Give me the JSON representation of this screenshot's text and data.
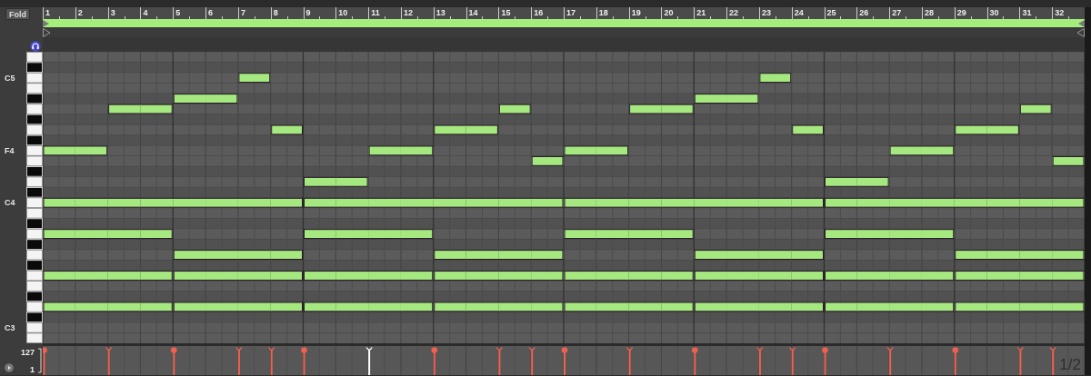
{
  "toolbar": {
    "fold_button": "Fold"
  },
  "ruler": {
    "bars": [
      "1",
      "2",
      "3",
      "4",
      "5",
      "6",
      "7",
      "8",
      "9",
      "10",
      "11",
      "12",
      "13",
      "14",
      "15",
      "16",
      "17",
      "18",
      "19",
      "20",
      "21",
      "22",
      "23",
      "24",
      "25",
      "26",
      "27",
      "28",
      "29",
      "30",
      "31",
      "32"
    ]
  },
  "rows": [
    {
      "black_key": false
    },
    {
      "black_key": true
    },
    {
      "black_key": false,
      "label": "C5",
      "bars": [
        {
          "on": false
        },
        {
          "on": false
        },
        {
          "on": false
        },
        {
          "on": false
        },
        {
          "on": false
        },
        {
          "on": false
        },
        {
          "on": true,
          "start": true,
          "selected": false
        },
        {
          "on": false
        },
        {
          "on": false
        },
        {
          "on": false
        },
        {
          "on": false
        },
        {
          "on": false
        },
        {
          "on": false
        },
        {
          "on": false
        },
        {
          "on": false
        },
        {
          "on": false
        },
        {
          "on": false
        },
        {
          "on": false
        },
        {
          "on": false
        },
        {
          "on": false
        },
        {
          "on": false
        },
        {
          "on": false
        },
        {
          "on": true,
          "start": true,
          "selected": false
        },
        {
          "on": false
        },
        {
          "on": false
        },
        {
          "on": false
        },
        {
          "on": false
        },
        {
          "on": false
        },
        {
          "on": false
        },
        {
          "on": false
        },
        {
          "on": false
        },
        {
          "on": false
        }
      ]
    },
    {
      "black_key": false
    },
    {
      "black_key": true,
      "bars": [
        {
          "on": false
        },
        {
          "on": false
        },
        {
          "on": false
        },
        {
          "on": false
        },
        {
          "on": true,
          "start": true,
          "selected": false
        },
        {
          "on": true,
          "start": false
        },
        {
          "on": false
        },
        {
          "on": false
        },
        {
          "on": false
        },
        {
          "on": false
        },
        {
          "on": false
        },
        {
          "on": false
        },
        {
          "on": false
        },
        {
          "on": false
        },
        {
          "on": false
        },
        {
          "on": false
        },
        {
          "on": false
        },
        {
          "on": false
        },
        {
          "on": false
        },
        {
          "on": false
        },
        {
          "on": true,
          "start": true,
          "selected": false
        },
        {
          "on": true,
          "start": false
        },
        {
          "on": false
        },
        {
          "on": false
        },
        {
          "on": false
        },
        {
          "on": false
        },
        {
          "on": false
        },
        {
          "on": false
        },
        {
          "on": false
        },
        {
          "on": false
        },
        {
          "on": false
        },
        {
          "on": false
        }
      ]
    },
    {
      "black_key": false,
      "bars": [
        {
          "on": false
        },
        {
          "on": false
        },
        {
          "on": true,
          "start": true,
          "selected": false
        },
        {
          "on": true,
          "start": false
        },
        {
          "on": false
        },
        {
          "on": false
        },
        {
          "on": false
        },
        {
          "on": false
        },
        {
          "on": false
        },
        {
          "on": false
        },
        {
          "on": false
        },
        {
          "on": false
        },
        {
          "on": false
        },
        {
          "on": false
        },
        {
          "on": true,
          "start": true,
          "selected": false
        },
        {
          "on": false
        },
        {
          "on": false
        },
        {
          "on": false
        },
        {
          "on": true,
          "start": true,
          "selected": false
        },
        {
          "on": true,
          "start": false
        },
        {
          "on": false
        },
        {
          "on": false
        },
        {
          "on": false
        },
        {
          "on": false
        },
        {
          "on": false
        },
        {
          "on": false
        },
        {
          "on": false
        },
        {
          "on": false
        },
        {
          "on": false
        },
        {
          "on": false
        },
        {
          "on": true,
          "start": true,
          "selected": false
        },
        {
          "on": false
        }
      ]
    },
    {
      "black_key": true
    },
    {
      "black_key": false,
      "bars": [
        {
          "on": false
        },
        {
          "on": false
        },
        {
          "on": false
        },
        {
          "on": false
        },
        {
          "on": false
        },
        {
          "on": false
        },
        {
          "on": false
        },
        {
          "on": true,
          "start": true,
          "selected": false
        },
        {
          "on": false
        },
        {
          "on": false
        },
        {
          "on": false
        },
        {
          "on": false
        },
        {
          "on": true,
          "start": true,
          "selected": false
        },
        {
          "on": true,
          "start": false
        },
        {
          "on": false
        },
        {
          "on": false
        },
        {
          "on": false
        },
        {
          "on": false
        },
        {
          "on": false
        },
        {
          "on": false
        },
        {
          "on": false
        },
        {
          "on": false
        },
        {
          "on": false
        },
        {
          "on": true,
          "start": true,
          "selected": false
        },
        {
          "on": false
        },
        {
          "on": false
        },
        {
          "on": false
        },
        {
          "on": false
        },
        {
          "on": true,
          "start": true,
          "selected": false
        },
        {
          "on": true,
          "start": false
        },
        {
          "on": false
        },
        {
          "on": false
        }
      ]
    },
    {
      "black_key": true
    },
    {
      "black_key": false,
      "label": "F4",
      "bars": [
        {
          "on": true,
          "start": true,
          "selected": false
        },
        {
          "on": true,
          "start": false
        },
        {
          "on": false
        },
        {
          "on": false
        },
        {
          "on": false
        },
        {
          "on": false
        },
        {
          "on": false
        },
        {
          "on": false
        },
        {
          "on": false
        },
        {
          "on": false
        },
        {
          "on": true,
          "start": true,
          "selected": true
        },
        {
          "on": true,
          "start": false
        },
        {
          "on": false
        },
        {
          "on": false
        },
        {
          "on": false
        },
        {
          "on": false
        },
        {
          "on": true,
          "start": true,
          "selected": false
        },
        {
          "on": true,
          "start": false
        },
        {
          "on": false
        },
        {
          "on": false
        },
        {
          "on": false
        },
        {
          "on": false
        },
        {
          "on": false
        },
        {
          "on": false
        },
        {
          "on": false
        },
        {
          "on": false
        },
        {
          "on": true,
          "start": true,
          "selected": false
        },
        {
          "on": true,
          "start": false
        },
        {
          "on": false
        },
        {
          "on": false
        },
        {
          "on": false
        },
        {
          "on": false
        }
      ]
    },
    {
      "black_key": false,
      "bars": [
        {
          "on": false
        },
        {
          "on": false
        },
        {
          "on": false
        },
        {
          "on": false
        },
        {
          "on": false
        },
        {
          "on": false
        },
        {
          "on": false
        },
        {
          "on": false
        },
        {
          "on": false
        },
        {
          "on": false
        },
        {
          "on": false
        },
        {
          "on": false
        },
        {
          "on": false
        },
        {
          "on": false
        },
        {
          "on": false
        },
        {
          "on": true,
          "start": true,
          "selected": false
        },
        {
          "on": false
        },
        {
          "on": false
        },
        {
          "on": false
        },
        {
          "on": false
        },
        {
          "on": false
        },
        {
          "on": false
        },
        {
          "on": false
        },
        {
          "on": false
        },
        {
          "on": false
        },
        {
          "on": false
        },
        {
          "on": false
        },
        {
          "on": false
        },
        {
          "on": false
        },
        {
          "on": false
        },
        {
          "on": false
        },
        {
          "on": true,
          "start": true,
          "selected": false
        }
      ]
    },
    {
      "black_key": true
    },
    {
      "black_key": false,
      "bars": [
        {
          "on": false
        },
        {
          "on": false
        },
        {
          "on": false
        },
        {
          "on": false
        },
        {
          "on": false
        },
        {
          "on": false
        },
        {
          "on": false
        },
        {
          "on": false
        },
        {
          "on": true,
          "start": true,
          "selected": false
        },
        {
          "on": true,
          "start": false
        },
        {
          "on": false
        },
        {
          "on": false
        },
        {
          "on": false
        },
        {
          "on": false
        },
        {
          "on": false
        },
        {
          "on": false
        },
        {
          "on": false
        },
        {
          "on": false
        },
        {
          "on": false
        },
        {
          "on": false
        },
        {
          "on": false
        },
        {
          "on": false
        },
        {
          "on": false
        },
        {
          "on": false
        },
        {
          "on": true,
          "start": true,
          "selected": false
        },
        {
          "on": true,
          "start": false
        },
        {
          "on": false
        },
        {
          "on": false
        },
        {
          "on": false
        },
        {
          "on": false
        },
        {
          "on": false
        },
        {
          "on": false
        }
      ]
    },
    {
      "black_key": true
    },
    {
      "black_key": false,
      "label": "C4",
      "bars": [
        {
          "on": true,
          "start": true,
          "selected": false
        },
        {
          "on": true,
          "start": false
        },
        {
          "on": true,
          "start": false
        },
        {
          "on": true,
          "start": false
        },
        {
          "on": true,
          "start": false
        },
        {
          "on": true,
          "start": false
        },
        {
          "on": true,
          "start": false
        },
        {
          "on": true,
          "start": false
        },
        {
          "on": true,
          "start": true,
          "selected": false
        },
        {
          "on": true,
          "start": false
        },
        {
          "on": true,
          "start": false
        },
        {
          "on": true,
          "start": false
        },
        {
          "on": true,
          "start": false
        },
        {
          "on": true,
          "start": false
        },
        {
          "on": true,
          "start": false
        },
        {
          "on": true,
          "start": false
        },
        {
          "on": true,
          "start": true,
          "selected": false
        },
        {
          "on": true,
          "start": false
        },
        {
          "on": true,
          "start": false
        },
        {
          "on": true,
          "start": false
        },
        {
          "on": true,
          "start": false
        },
        {
          "on": true,
          "start": false
        },
        {
          "on": true,
          "start": false
        },
        {
          "on": true,
          "start": false
        },
        {
          "on": true,
          "start": true,
          "selected": false
        },
        {
          "on": true,
          "start": false
        },
        {
          "on": true,
          "start": false
        },
        {
          "on": true,
          "start": false
        },
        {
          "on": true,
          "start": false
        },
        {
          "on": true,
          "start": false
        },
        {
          "on": true,
          "start": false
        },
        {
          "on": true,
          "start": false
        }
      ]
    },
    {
      "black_key": false
    },
    {
      "black_key": true
    },
    {
      "black_key": false,
      "bars": [
        {
          "on": true,
          "start": true,
          "selected": false
        },
        {
          "on": true,
          "start": false
        },
        {
          "on": true,
          "start": false
        },
        {
          "on": true,
          "start": false
        },
        {
          "on": false
        },
        {
          "on": false
        },
        {
          "on": false
        },
        {
          "on": false
        },
        {
          "on": true,
          "start": true,
          "selected": false
        },
        {
          "on": true,
          "start": false
        },
        {
          "on": true,
          "start": false
        },
        {
          "on": true,
          "start": false
        },
        {
          "on": false
        },
        {
          "on": false
        },
        {
          "on": false
        },
        {
          "on": false
        },
        {
          "on": true,
          "start": true,
          "selected": false
        },
        {
          "on": true,
          "start": false
        },
        {
          "on": true,
          "start": false
        },
        {
          "on": true,
          "start": false
        },
        {
          "on": false
        },
        {
          "on": false
        },
        {
          "on": false
        },
        {
          "on": false
        },
        {
          "on": true,
          "start": true,
          "selected": false
        },
        {
          "on": true,
          "start": false
        },
        {
          "on": true,
          "start": false
        },
        {
          "on": true,
          "start": false
        },
        {
          "on": false
        },
        {
          "on": false
        },
        {
          "on": false
        },
        {
          "on": false
        }
      ]
    },
    {
      "black_key": true
    },
    {
      "black_key": false,
      "bars": [
        {
          "on": false
        },
        {
          "on": false
        },
        {
          "on": false
        },
        {
          "on": false
        },
        {
          "on": true,
          "start": true,
          "selected": false
        },
        {
          "on": true,
          "start": false
        },
        {
          "on": true,
          "start": false
        },
        {
          "on": true,
          "start": false
        },
        {
          "on": false
        },
        {
          "on": false
        },
        {
          "on": false
        },
        {
          "on": false
        },
        {
          "on": true,
          "start": true,
          "selected": false
        },
        {
          "on": true,
          "start": false
        },
        {
          "on": true,
          "start": false
        },
        {
          "on": true,
          "start": false
        },
        {
          "on": false
        },
        {
          "on": false
        },
        {
          "on": false
        },
        {
          "on": false
        },
        {
          "on": true,
          "start": true,
          "selected": false
        },
        {
          "on": true,
          "start": false
        },
        {
          "on": true,
          "start": false
        },
        {
          "on": true,
          "start": false
        },
        {
          "on": false
        },
        {
          "on": false
        },
        {
          "on": false
        },
        {
          "on": false
        },
        {
          "on": true,
          "start": true,
          "selected": false
        },
        {
          "on": true,
          "start": false
        },
        {
          "on": true,
          "start": false
        },
        {
          "on": true,
          "start": false
        }
      ]
    },
    {
      "black_key": true
    },
    {
      "black_key": false,
      "bars": [
        {
          "on": true,
          "start": true,
          "selected": false
        },
        {
          "on": true,
          "start": false
        },
        {
          "on": true,
          "start": false
        },
        {
          "on": true,
          "start": false
        },
        {
          "on": true,
          "start": true,
          "selected": false
        },
        {
          "on": true,
          "start": false
        },
        {
          "on": true,
          "start": false
        },
        {
          "on": true,
          "start": false
        },
        {
          "on": true,
          "start": true,
          "selected": false
        },
        {
          "on": true,
          "start": false
        },
        {
          "on": true,
          "start": false
        },
        {
          "on": true,
          "start": false
        },
        {
          "on": true,
          "start": true,
          "selected": false
        },
        {
          "on": true,
          "start": false
        },
        {
          "on": true,
          "start": false
        },
        {
          "on": true,
          "start": false
        },
        {
          "on": true,
          "start": true,
          "selected": false
        },
        {
          "on": true,
          "start": false
        },
        {
          "on": true,
          "start": false
        },
        {
          "on": true,
          "start": false
        },
        {
          "on": true,
          "start": true,
          "selected": false
        },
        {
          "on": true,
          "start": false
        },
        {
          "on": true,
          "start": false
        },
        {
          "on": true,
          "start": false
        },
        {
          "on": true,
          "start": true,
          "selected": false
        },
        {
          "on": true,
          "start": false
        },
        {
          "on": true,
          "start": false
        },
        {
          "on": true,
          "start": false
        },
        {
          "on": true,
          "start": true,
          "selected": false
        },
        {
          "on": true,
          "start": false
        },
        {
          "on": true,
          "start": false
        },
        {
          "on": true,
          "start": false
        }
      ]
    },
    {
      "black_key": false
    },
    {
      "black_key": true
    },
    {
      "black_key": false,
      "bars": [
        {
          "on": true,
          "start": true,
          "selected": false
        },
        {
          "on": true,
          "start": false
        },
        {
          "on": true,
          "start": false
        },
        {
          "on": true,
          "start": false
        },
        {
          "on": true,
          "start": true,
          "selected": false
        },
        {
          "on": true,
          "start": false
        },
        {
          "on": true,
          "start": false
        },
        {
          "on": true,
          "start": false
        },
        {
          "on": true,
          "start": true,
          "selected": false
        },
        {
          "on": true,
          "start": false
        },
        {
          "on": true,
          "start": false
        },
        {
          "on": true,
          "start": false
        },
        {
          "on": true,
          "start": true,
          "selected": false
        },
        {
          "on": true,
          "start": false
        },
        {
          "on": true,
          "start": false
        },
        {
          "on": true,
          "start": false
        },
        {
          "on": true,
          "start": true,
          "selected": false
        },
        {
          "on": true,
          "start": false
        },
        {
          "on": true,
          "start": false
        },
        {
          "on": true,
          "start": false
        },
        {
          "on": true,
          "start": true,
          "selected": false
        },
        {
          "on": true,
          "start": false
        },
        {
          "on": true,
          "start": false
        },
        {
          "on": true,
          "start": false
        },
        {
          "on": true,
          "start": true,
          "selected": false
        },
        {
          "on": true,
          "start": false
        },
        {
          "on": true,
          "start": false
        },
        {
          "on": true,
          "start": false
        },
        {
          "on": true,
          "start": true,
          "selected": false
        },
        {
          "on": true,
          "start": false
        },
        {
          "on": true,
          "start": false
        },
        {
          "on": true,
          "start": false
        }
      ]
    },
    {
      "black_key": true
    },
    {
      "black_key": false,
      "label": "C3"
    },
    {
      "black_key": false
    }
  ],
  "velocity_lane": {
    "max": "127",
    "min": "1",
    "page": "1/2"
  }
}
